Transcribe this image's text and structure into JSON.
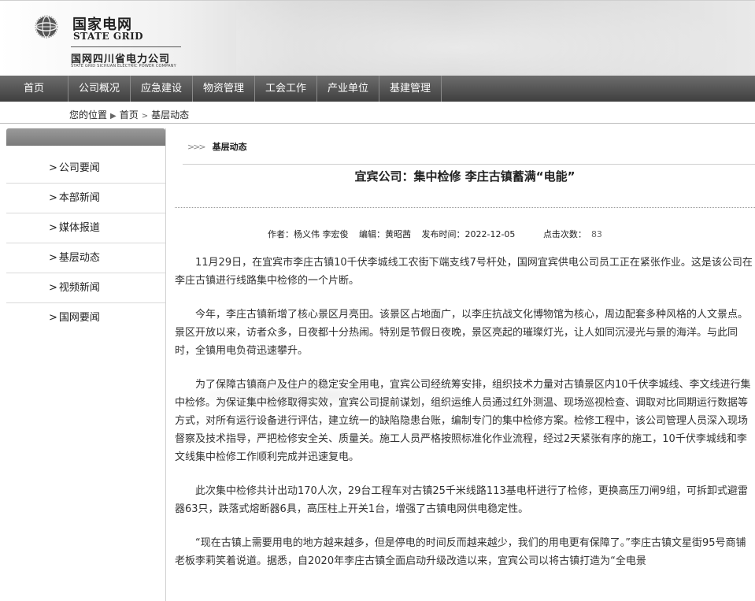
{
  "header": {
    "logo_cn": "国家电网",
    "logo_en": "STATE GRID",
    "company": "国网四川省电力公司",
    "company_en": "STATE GRID SICHUAN ELECTRIC POWER COMPANY"
  },
  "nav": {
    "items": [
      {
        "label": "首页"
      },
      {
        "label": "公司概况"
      },
      {
        "label": "应急建设"
      },
      {
        "label": "物资管理"
      },
      {
        "label": "工会工作"
      },
      {
        "label": "产业单位"
      },
      {
        "label": "基建管理"
      }
    ]
  },
  "breadcrumb": {
    "prefix": "您的位置",
    "home": "首页",
    "current": "基层动态"
  },
  "sidebar": {
    "items": [
      {
        "label": "公司要闻"
      },
      {
        "label": "本部新闻"
      },
      {
        "label": "媒体报道"
      },
      {
        "label": "基层动态"
      },
      {
        "label": "视频新闻"
      },
      {
        "label": "国网要闻"
      }
    ]
  },
  "main": {
    "section": "基层动态",
    "title": "宜宾公司：集中检修 李庄古镇蓄满“电能”",
    "meta": {
      "author": "作者：杨义伟 李宏俊",
      "editor": "编辑：黄昭茜",
      "date": "发布时间：2022-12-05",
      "hits_label": "点击次数：",
      "hits": "83"
    },
    "paragraphs": [
      "11月29日，在宜宾市李庄古镇10千伏李城线工农街下端支线7号杆处，国网宜宾供电公司员工正在紧张作业。这是该公司在李庄古镇进行线路集中检修的一个片断。",
      "今年，李庄古镇新增了核心景区月亮田。该景区占地面广，以李庄抗战文化博物馆为核心，周边配套多种风格的人文景点。景区开放以来，访者众多，日夜都十分热闹。特别是节假日夜晚，景区亮起的璀璨灯光，让人如同沉浸光与景的海洋。与此同时，全镇用电负荷迅速攀升。",
      "为了保障古镇商户及住户的稳定安全用电，宜宾公司经统筹安排，组织技术力量对古镇景区内10千伏李城线、李文线进行集中检修。为保证集中检修取得实效，宜宾公司提前谋划，组织运维人员通过红外测温、现场巡视检查、调取对比同期运行数据等方式，对所有运行设备进行评估，建立统一的缺陷隐患台账，编制专门的集中检修方案。检修工程中，该公司管理人员深入现场督察及技术指导，严把检修安全关、质量关。施工人员严格按照标准化作业流程，经过2天紧张有序的施工，10千伏李城线和李文线集中检修工作顺利完成并迅速复电。",
      "此次集中检修共计出动170人次，29台工程车对古镇25千米线路113基电杆进行了检修，更换高压刀闸9组，可拆卸式避雷器63只，跌落式熔断器6具，高压柱上开关1台，增强了古镇电网供电稳定性。",
      "“现在古镇上需要用电的地方越来越多，但是停电的时间反而越来越少，我们的用电更有保障了。”李庄古镇文星街95号商铺老板李莉笑着说道。据悉，自2020年李庄古镇全面启动升级改造以来，宜宾公司以将古镇打造为“全电景"
    ]
  }
}
